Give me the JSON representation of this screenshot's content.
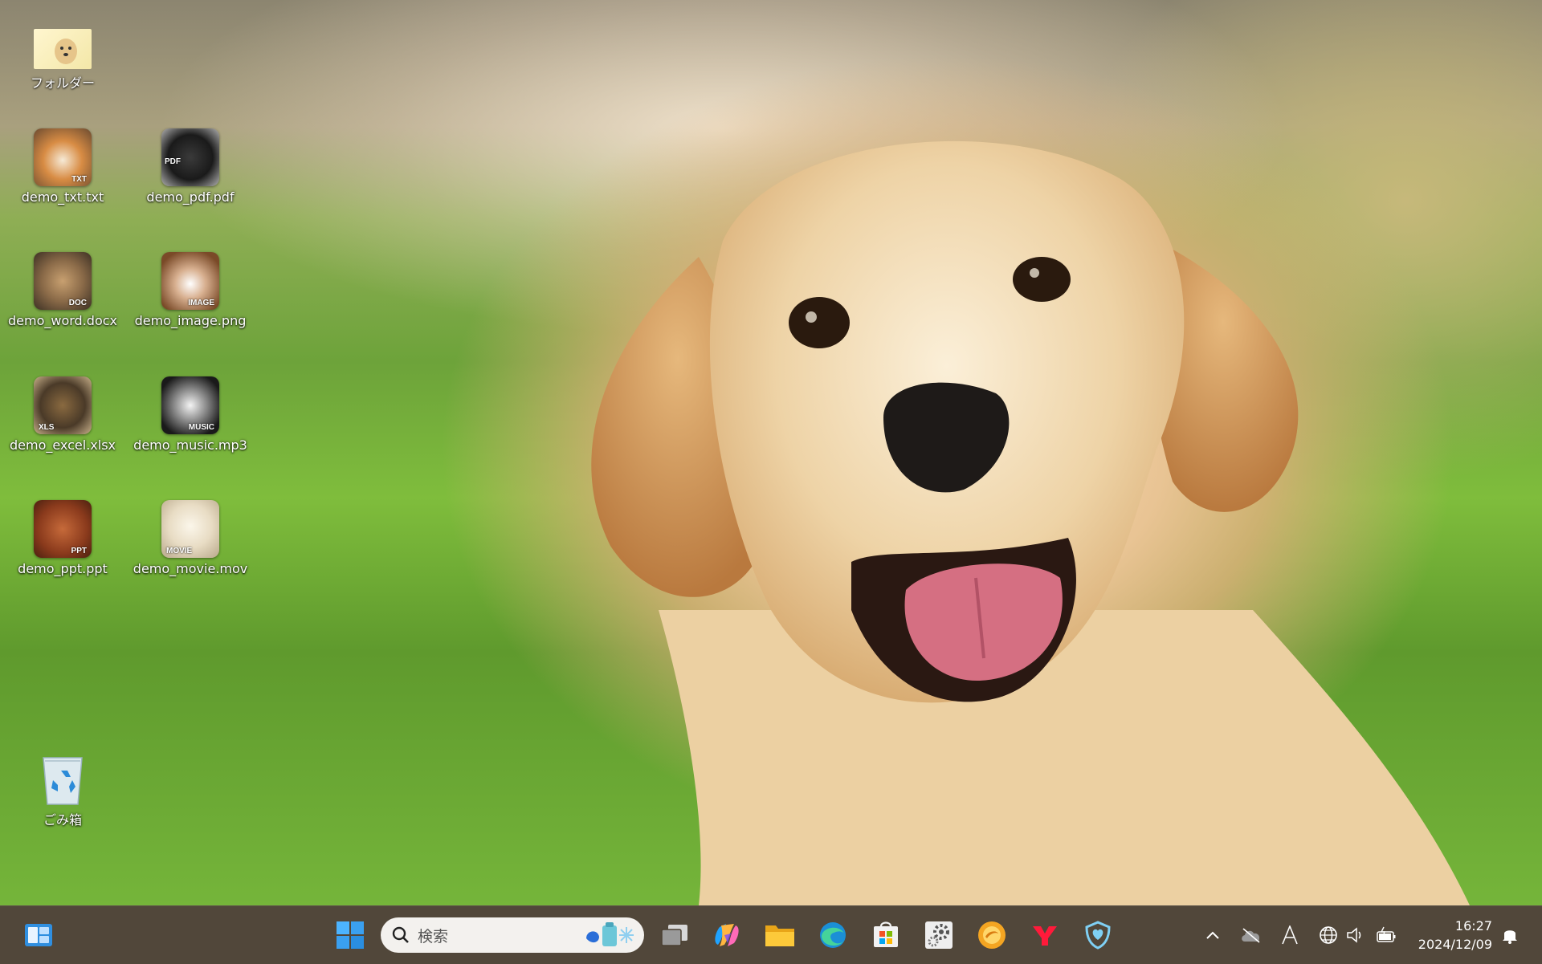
{
  "desktop": {
    "icons": [
      {
        "label": "フォルダー"
      },
      {
        "label": "demo_txt.txt",
        "badge": "TXT"
      },
      {
        "label": "demo_pdf.pdf",
        "badge": "PDF"
      },
      {
        "label": "demo_word.docx",
        "badge": "DOC"
      },
      {
        "label": "demo_image.png",
        "badge": "IMAGE"
      },
      {
        "label": "demo_excel.xlsx",
        "badge": "XLS"
      },
      {
        "label": "demo_music.mp3",
        "badge": "MUSIC"
      },
      {
        "label": "demo_ppt.ppt",
        "badge": "PPT"
      },
      {
        "label": "demo_movie.mov",
        "badge": "MOVIE"
      },
      {
        "label": "ごみ箱"
      }
    ]
  },
  "taskbar": {
    "search_placeholder": "検索",
    "apps": [
      "widgets-icon",
      "start-icon",
      "task-view-icon",
      "copilot-icon",
      "file-explorer-icon",
      "edge-icon",
      "store-icon",
      "settings-icon",
      "coin-app-icon",
      "yahoo-icon",
      "care-app-icon"
    ],
    "clock": {
      "time": "16:27",
      "date": "2024/12/09"
    }
  },
  "colors": {
    "taskbar_bg": "#4a4032",
    "start_blue": "#3aa0f0"
  }
}
